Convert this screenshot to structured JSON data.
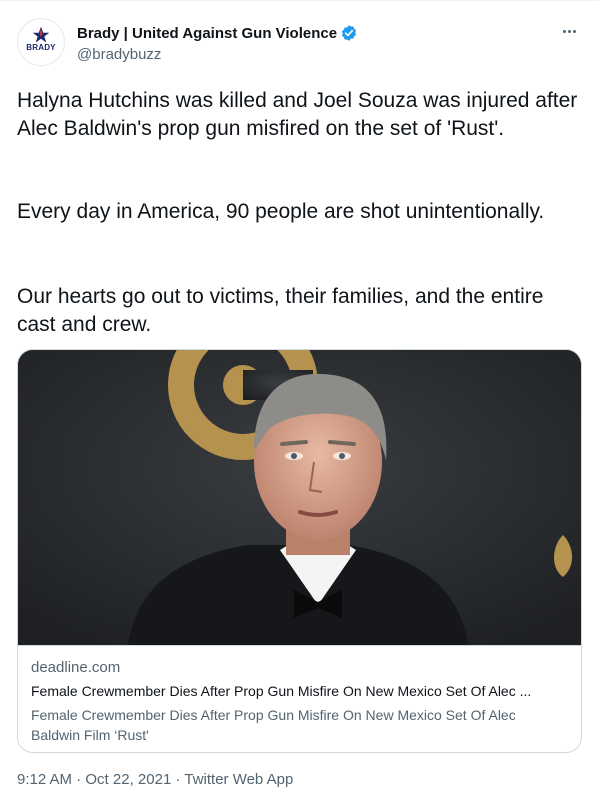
{
  "author": {
    "name": "Brady | United Against Gun Violence",
    "handle": "@bradybuzz",
    "avatar_text": "BRADY",
    "verified": true,
    "verified_color": "#1d9bf0"
  },
  "tweet": {
    "paragraphs": [
      "Halyna Hutchins was killed and Joel Souza was injured after Alec Baldwin's prop gun misfired on the set of 'Rust'.",
      "Every day in America, 90 people are shot unintentionally.",
      "Our hearts go out to victims, their families, and the entire cast and crew."
    ]
  },
  "card": {
    "domain": "deadline.com",
    "title": "Female Crewmember Dies After Prop Gun Misfire On New Mexico Set Of Alec ...",
    "description": "Female Crewmember Dies After Prop Gun Misfire On New Mexico Set Of Alec Baldwin Film ‘Rust'"
  },
  "meta": {
    "time": "9:12 AM",
    "separator1": " · ",
    "date": "Oct 22, 2021",
    "separator2": " · ",
    "source": "Twitter Web App"
  },
  "icons": {
    "more": "more-horizontal-icon",
    "verified": "verified-badge-icon",
    "avatar_star": "star-icon"
  },
  "colors": {
    "text_primary": "#0f1419",
    "text_secondary": "#536471",
    "border": "#cfd9de",
    "brand_navy": "#1f2a6b",
    "brand_red": "#c9323b"
  }
}
